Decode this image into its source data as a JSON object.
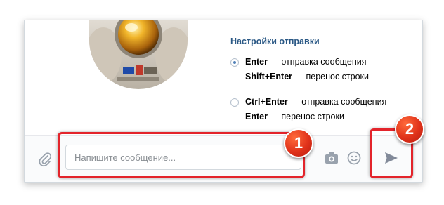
{
  "settings": {
    "title": "Настройки отправки",
    "options": [
      {
        "selected": true,
        "line1_key": "Enter",
        "line1_text": " — отправка сообщения",
        "line2_key": "Shift+Enter",
        "line2_text": " — перенос строки"
      },
      {
        "selected": false,
        "line1_key": "Ctrl+Enter",
        "line1_text": " — отправка сообщения",
        "line2_key": "Enter",
        "line2_text": " — перенос строки"
      }
    ]
  },
  "composer": {
    "placeholder": "Напишите сообщение...",
    "attach_icon": "paperclip-icon",
    "camera_icon": "camera-icon",
    "emoji_icon": "smiley-icon",
    "send_icon": "send-arrow-icon"
  },
  "annotations": {
    "badge1": "1",
    "badge2": "2",
    "color": "#e3242b"
  },
  "sticker": {
    "icon": "astronaut-sticker-icon"
  }
}
